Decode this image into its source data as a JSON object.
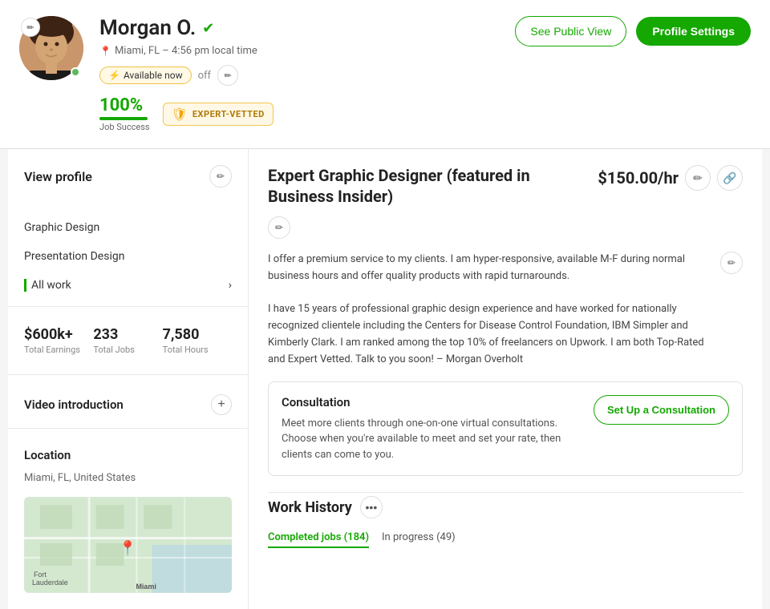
{
  "header": {
    "name": "Morgan O.",
    "verified": true,
    "location": "Miami, FL – 4:56 pm local time",
    "availability": "Available now",
    "availability_off": "off",
    "job_success_pct": "100%",
    "job_success_label": "Job Success",
    "expert_label": "EXPERT-VETTED",
    "btn_see_public": "See Public View",
    "btn_profile_settings": "Profile Settings"
  },
  "sidebar": {
    "view_profile_title": "View profile",
    "nav_items": [
      {
        "label": "Graphic Design",
        "active": false
      },
      {
        "label": "Presentation Design",
        "active": false
      },
      {
        "label": "All work",
        "active": true
      }
    ],
    "stats": [
      {
        "value": "$600k+",
        "label": "Total Earnings"
      },
      {
        "value": "233",
        "label": "Total Jobs"
      },
      {
        "value": "7,580",
        "label": "Total Hours"
      }
    ],
    "video_intro_label": "Video introduction",
    "location_section_label": "Location",
    "location_text": "Miami, FL, United States",
    "map_label": "Fort Lauderdale"
  },
  "main": {
    "job_title": "Expert Graphic Designer (featured in Business Insider)",
    "rate": "$150.00/hr",
    "bio_para1": "I offer a premium service to my clients. I am hyper-responsive, available M-F during normal business hours and offer quality products with rapid turnarounds.",
    "bio_para2": "I have 15 years of professional graphic design experience and have worked for nationally recognized clientele including the Centers for Disease Control Foundation, IBM Simpler and Kimberly Clark. I am ranked among the top 10% of freelancers on Upwork. I am both Top-Rated and Expert Vetted. Talk to you soon! – Morgan Overholt",
    "consultation": {
      "title": "Consultation",
      "description": "Meet more clients through one-on-one virtual consultations. Choose when you're available to meet and set your rate, then clients can come to you.",
      "btn_label": "Set Up a Consultation"
    },
    "work_history": {
      "title": "Work History",
      "tab_completed": "Completed jobs (184)",
      "tab_in_progress": "In progress (49)"
    }
  }
}
